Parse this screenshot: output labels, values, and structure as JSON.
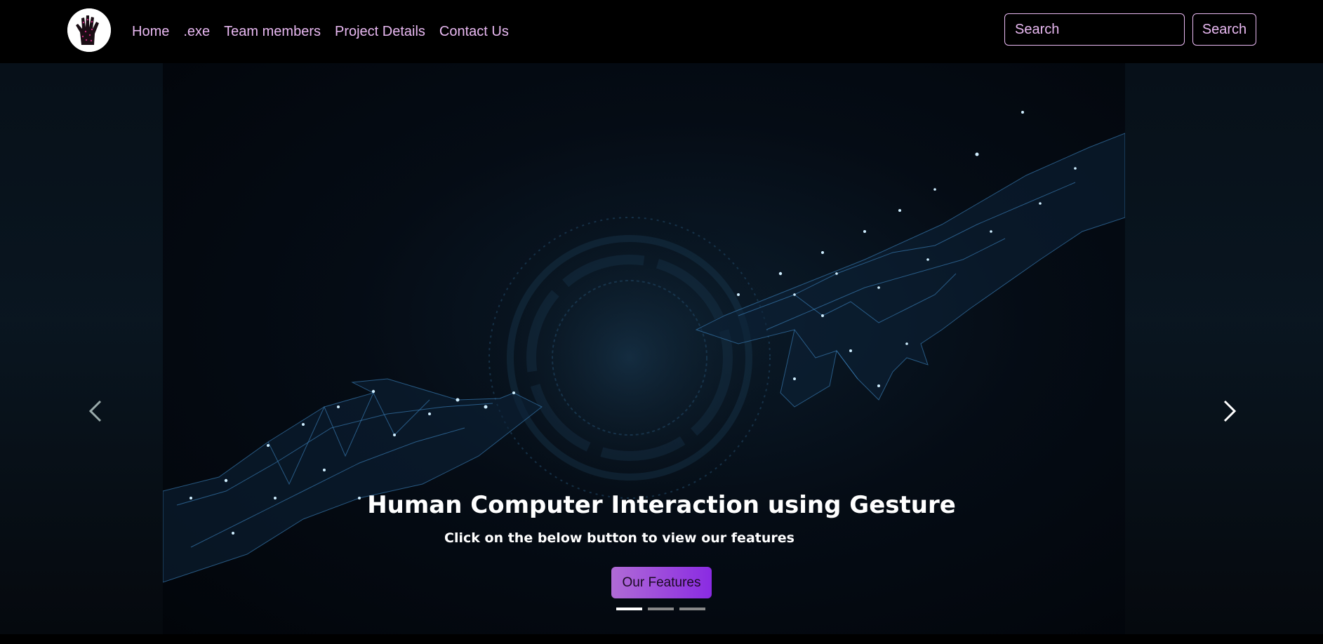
{
  "nav": {
    "logo_icon": "hand-logo-icon",
    "links": [
      "Home",
      ".exe",
      "Team members",
      "Project Details",
      "Contact Us"
    ],
    "search": {
      "placeholder": "Search",
      "value": "",
      "button_label": "Search"
    },
    "accent_color": "#e9b9f2"
  },
  "hero": {
    "title": "Human Computer Interaction using Gesture",
    "subtitle": "Click on the below button to view our features",
    "cta_label": "Our Features",
    "prev_icon": "chevron-left-icon",
    "next_icon": "chevron-right-icon",
    "slides_count": 3,
    "active_slide": 0,
    "image_icon": "two-wireframe-hands-reaching-image"
  }
}
